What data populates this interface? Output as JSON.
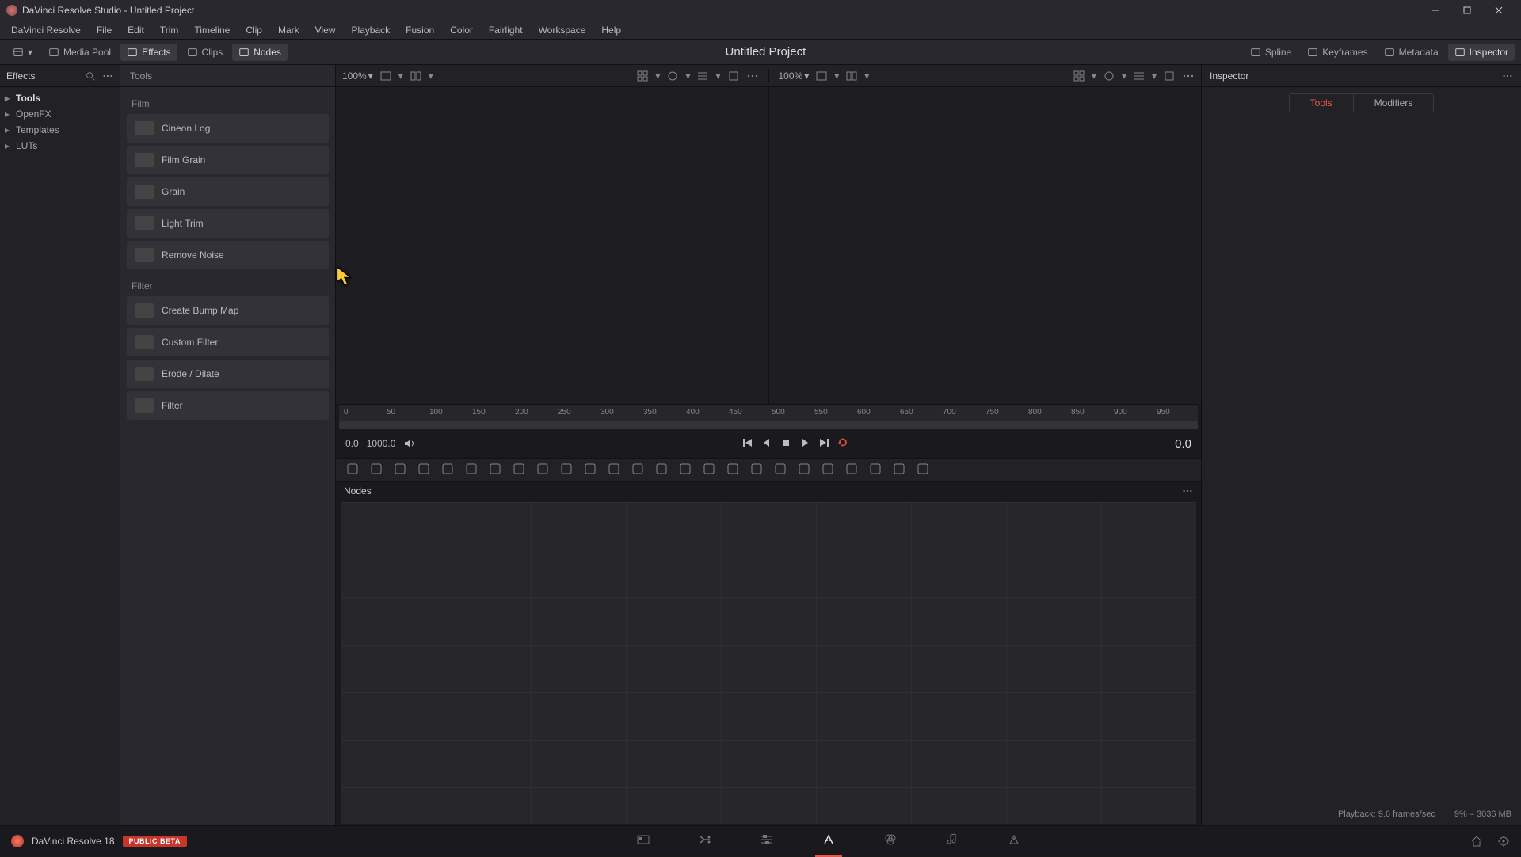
{
  "window": {
    "title": "DaVinci Resolve Studio - Untitled Project"
  },
  "menubar": [
    "DaVinci Resolve",
    "File",
    "Edit",
    "Trim",
    "Timeline",
    "Clip",
    "Mark",
    "View",
    "Playback",
    "Fusion",
    "Color",
    "Fairlight",
    "Workspace",
    "Help"
  ],
  "toolbar": {
    "left": [
      {
        "name": "mediapool",
        "label": "Media Pool"
      },
      {
        "name": "effects",
        "label": "Effects",
        "active": true
      },
      {
        "name": "clips",
        "label": "Clips"
      },
      {
        "name": "nodes",
        "label": "Nodes",
        "active": true
      }
    ],
    "project_title": "Untitled Project",
    "right": [
      {
        "name": "spline",
        "label": "Spline"
      },
      {
        "name": "keyframes",
        "label": "Keyframes"
      },
      {
        "name": "metadata",
        "label": "Metadata"
      },
      {
        "name": "inspector",
        "label": "Inspector",
        "active": true
      }
    ]
  },
  "effects_panel": {
    "title": "Effects",
    "tree": [
      {
        "label": "Tools",
        "selected": true,
        "expandable": true
      },
      {
        "label": "OpenFX",
        "expandable": true
      },
      {
        "label": "Templates",
        "expandable": true
      },
      {
        "label": "LUTs",
        "expandable": true
      }
    ]
  },
  "tools_column": {
    "header": "Tools",
    "groups": [
      {
        "category": "Film",
        "items": [
          "Cineon Log",
          "Film Grain",
          "Grain",
          "Light Trim",
          "Remove Noise"
        ]
      },
      {
        "category": "Filter",
        "items": [
          "Create Bump Map",
          "Custom Filter",
          "Erode / Dilate",
          "Filter"
        ]
      }
    ]
  },
  "viewer": {
    "zoom_left": "100%",
    "zoom_right": "100%",
    "ruler_ticks": [
      "0",
      "50",
      "100",
      "150",
      "200",
      "250",
      "300",
      "350",
      "400",
      "450",
      "500",
      "550",
      "600",
      "650",
      "700",
      "750",
      "800",
      "850",
      "900",
      "950"
    ]
  },
  "transport": {
    "time_in": "0.0",
    "time_out": "1000.0",
    "time_current": "0.0"
  },
  "nodes_panel": {
    "title": "Nodes"
  },
  "inspector": {
    "title": "Inspector",
    "tabs": [
      {
        "label": "Tools",
        "active": true
      },
      {
        "label": "Modifiers"
      }
    ]
  },
  "status": {
    "playback": "Playback: 9.6 frames/sec",
    "memory": "9% – 3036 MB"
  },
  "bottom": {
    "app_name": "DaVinci Resolve 18",
    "badge": "PUBLIC BETA"
  }
}
